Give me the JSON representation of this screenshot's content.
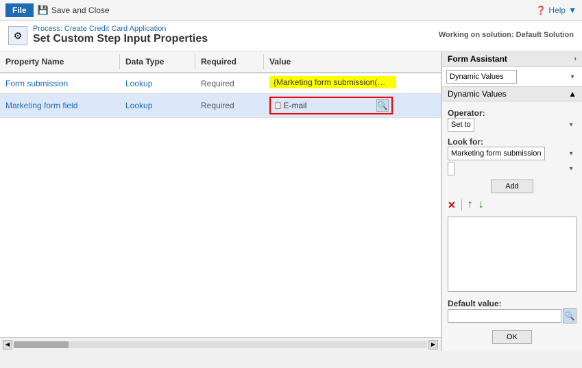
{
  "toolbar": {
    "file_label": "File",
    "save_close_label": "Save and Close",
    "help_label": "Help"
  },
  "header": {
    "breadcrumb": "Process: Create Credit Card Application",
    "title": "Set Custom Step Input Properties",
    "solution": "Working on solution: Default Solution"
  },
  "table": {
    "columns": [
      "Property Name",
      "Data Type",
      "Required",
      "Value"
    ],
    "rows": [
      {
        "property": "Form submission",
        "dataType": "Lookup",
        "required": "Required",
        "value": "{Marketing form submission(Mark",
        "valueType": "yellow"
      },
      {
        "property": "Marketing form field",
        "dataType": "Lookup",
        "required": "Required",
        "value": "E-mail",
        "valueType": "email"
      }
    ]
  },
  "form_assistant": {
    "title": "Form Assistant",
    "chevron": "›",
    "dynamic_values_select": "Dynamic Values",
    "dynamic_values_section": "Dynamic Values",
    "collapse_icon": "▲",
    "operator_label": "Operator:",
    "operator_value": "Set to",
    "look_for_label": "Look for:",
    "look_for_value": "Marketing form submission",
    "look_for_sub": "",
    "add_label": "Add",
    "delete_icon": "✕",
    "up_icon": "↑",
    "down_icon": "↓",
    "default_value_label": "Default value:",
    "ok_label": "OK"
  }
}
